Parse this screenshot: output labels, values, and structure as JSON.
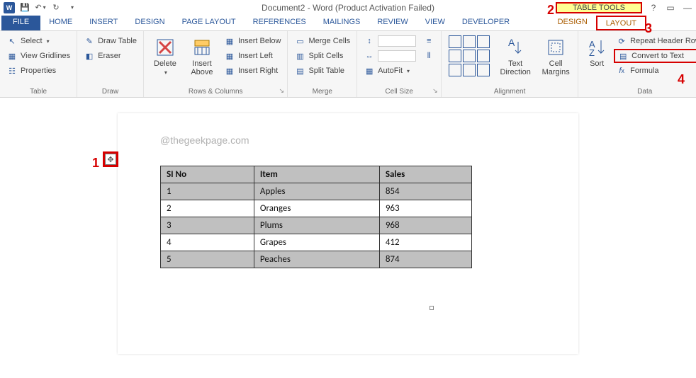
{
  "title": "Document2 - Word (Product Activation Failed)",
  "table_tools_label": "TABLE TOOLS",
  "tabs": {
    "file": "FILE",
    "home": "HOME",
    "insert": "INSERT",
    "design": "DESIGN",
    "page_layout": "PAGE LAYOUT",
    "references": "REFERENCES",
    "mailings": "MAILINGS",
    "review": "REVIEW",
    "view": "VIEW",
    "developer": "DEVELOPER",
    "ctx_design": "DESIGN",
    "ctx_layout": "LAYOUT"
  },
  "groups": {
    "table": {
      "label": "Table",
      "select": "Select",
      "view_gridlines": "View Gridlines",
      "properties": "Properties"
    },
    "draw": {
      "label": "Draw",
      "draw_table": "Draw Table",
      "eraser": "Eraser"
    },
    "rows_cols": {
      "label": "Rows & Columns",
      "delete": "Delete",
      "insert_above": "Insert\nAbove",
      "insert_below": "Insert Below",
      "insert_left": "Insert Left",
      "insert_right": "Insert Right"
    },
    "merge": {
      "label": "Merge",
      "merge_cells": "Merge Cells",
      "split_cells": "Split Cells",
      "split_table": "Split Table"
    },
    "cell_size": {
      "label": "Cell Size",
      "autofit": "AutoFit"
    },
    "alignment": {
      "label": "Alignment",
      "text_direction": "Text\nDirection",
      "cell_margins": "Cell\nMargins"
    },
    "data": {
      "label": "Data",
      "sort": "Sort",
      "repeat_header": "Repeat Header Rows",
      "convert_text": "Convert to Text",
      "formula": "Formula"
    }
  },
  "annotations": {
    "a1": "1",
    "a2": "2",
    "a3": "3",
    "a4": "4"
  },
  "watermark": "@thegeekpage.com",
  "chart_data": {
    "type": "table",
    "columns": [
      "SI No",
      "Item",
      "Sales"
    ],
    "rows": [
      [
        "1",
        "Apples",
        "854"
      ],
      [
        "2",
        "Oranges",
        "963"
      ],
      [
        "3",
        "Plums",
        "968"
      ],
      [
        "4",
        "Grapes",
        "412"
      ],
      [
        "5",
        "Peaches",
        "874"
      ]
    ]
  }
}
